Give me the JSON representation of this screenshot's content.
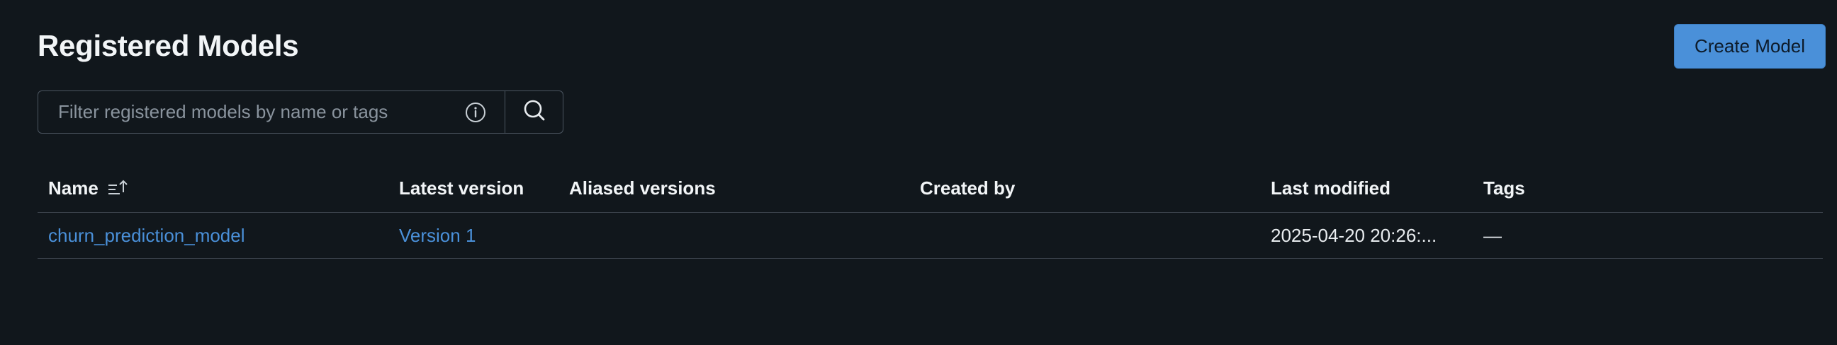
{
  "header": {
    "title": "Registered Models",
    "create_button_label": "Create Model"
  },
  "search": {
    "placeholder": "Filter registered models by name or tags",
    "value": ""
  },
  "icons": {
    "info": "info-icon",
    "search": "search-icon",
    "sort": "sort-ascending-icon"
  },
  "colors": {
    "background": "#11171c",
    "accent": "#4a90d9",
    "link": "#4a90d9",
    "border": "#3c444d"
  },
  "table": {
    "columns": [
      {
        "key": "name",
        "label": "Name"
      },
      {
        "key": "latest_version",
        "label": "Latest version"
      },
      {
        "key": "aliased_versions",
        "label": "Aliased versions"
      },
      {
        "key": "created_by",
        "label": "Created by"
      },
      {
        "key": "last_modified",
        "label": "Last modified"
      },
      {
        "key": "tags",
        "label": "Tags"
      }
    ],
    "rows": [
      {
        "name": "churn_prediction_model",
        "latest_version": "Version 1",
        "aliased_versions": "",
        "created_by": "",
        "last_modified": "2025-04-20 20:26:...",
        "tags": "—"
      }
    ]
  }
}
